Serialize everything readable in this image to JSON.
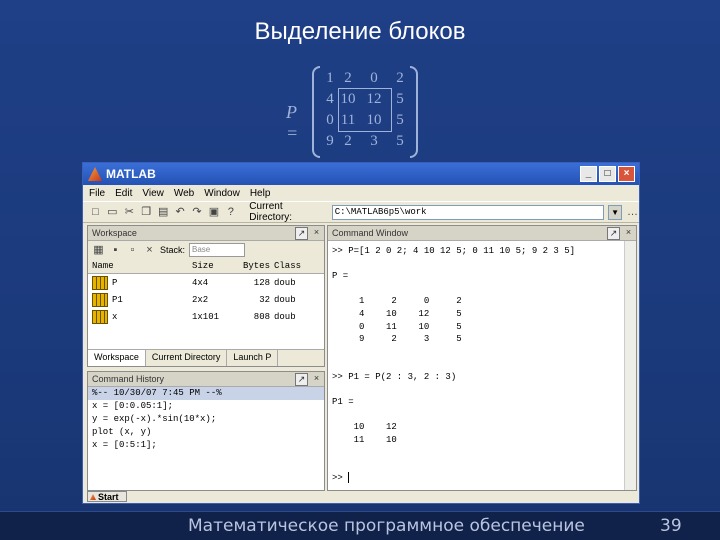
{
  "slide": {
    "title": "Выделение блоков",
    "footer": "Математическое программное обеспечение",
    "page_number": "39"
  },
  "matrix": {
    "label": "P =",
    "rows": [
      [
        "1",
        "2",
        "0",
        "2"
      ],
      [
        "4",
        "10",
        "12",
        "5"
      ],
      [
        "0",
        "11",
        "10",
        "5"
      ],
      [
        "9",
        "2",
        "3",
        "5"
      ]
    ]
  },
  "matlab": {
    "window_title": "MATLAB",
    "title_buttons": [
      "_",
      "□",
      "×"
    ],
    "menu": [
      "File",
      "Edit",
      "View",
      "Web",
      "Window",
      "Help"
    ],
    "current_dir_label": "Current Directory:",
    "current_dir_value": "C:\\MATLAB6p5\\work",
    "workspace": {
      "title": "Workspace",
      "stack_label": "Stack:",
      "stack_value": "Base",
      "columns": [
        "Name",
        "Size",
        "Bytes",
        "Class"
      ],
      "rows": [
        {
          "name": "P",
          "size": "4x4",
          "bytes": "128",
          "class": "doub"
        },
        {
          "name": "P1",
          "size": "2x2",
          "bytes": "32",
          "class": "doub"
        },
        {
          "name": "x",
          "size": "1x101",
          "bytes": "808",
          "class": "doub"
        }
      ],
      "tabs": [
        "Workspace",
        "Current Directory",
        "Launch P"
      ]
    },
    "history": {
      "title": "Command History",
      "lines": [
        "%-- 10/30/07  7:45 PM --%",
        "x = [0:0.05:1];",
        "y = exp(-x).*sin(10*x);",
        "plot (x, y)",
        "x = [0:5:1];"
      ]
    },
    "command_window": {
      "title": "Command Window",
      "lines": [
        ">> P=[1 2 0 2; 4 10 12 5; 0 11 10 5; 9 2 3 5]",
        "",
        "P =",
        "",
        "     1     2     0     2",
        "     4    10    12     5",
        "     0    11    10     5",
        "     9     2     3     5",
        "",
        "",
        ">> P1 = P(2 : 3, 2 : 3)",
        "",
        "P1 =",
        "",
        "    10    12",
        "    11    10",
        "",
        ""
      ],
      "prompt": ">> "
    },
    "start_label": "Start"
  }
}
